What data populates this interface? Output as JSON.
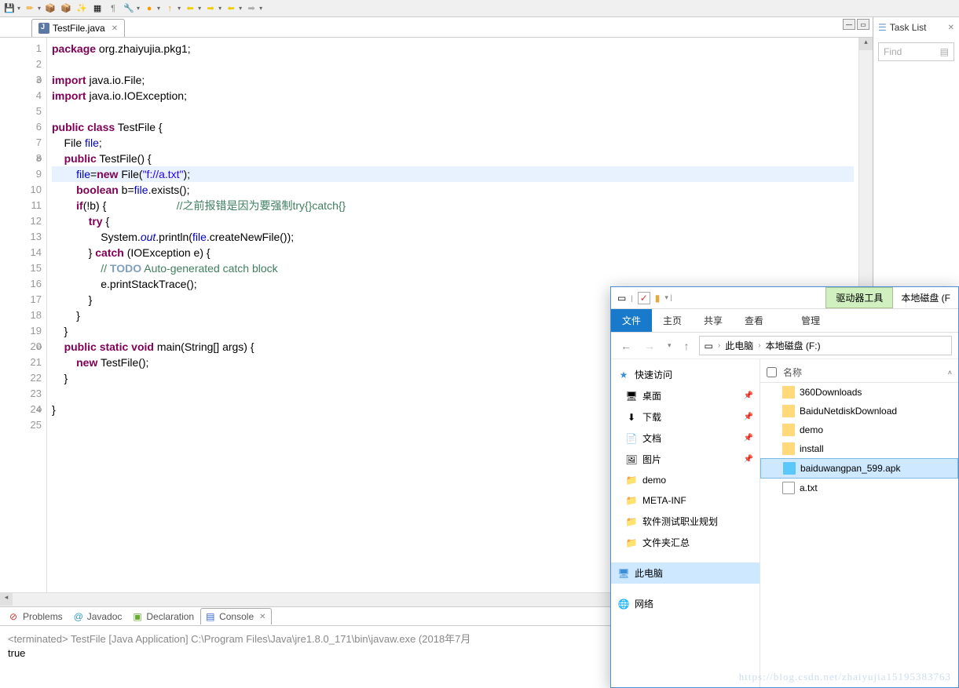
{
  "toolbar": {
    "icons": [
      "disk",
      "pencil",
      "box",
      "pkg",
      "run",
      "grid",
      "para",
      "wand",
      "dot",
      "up",
      "left",
      "right",
      "left2",
      "right2"
    ]
  },
  "tab": {
    "name": "TestFile.java",
    "close": "✕"
  },
  "code": {
    "lines": [
      {
        "n": 1,
        "html": "<span class='kw'>package</span> org.zhaiyujia.pkg1;"
      },
      {
        "n": 2,
        "html": ""
      },
      {
        "n": 3,
        "html": "<span class='kw'>import</span> java.io.File;",
        "fold": "⊖"
      },
      {
        "n": 4,
        "html": "<span class='kw'>import</span> java.io.IOException;"
      },
      {
        "n": 5,
        "html": ""
      },
      {
        "n": 6,
        "html": "<span class='kw'>public</span> <span class='kw'>class</span> TestFile {"
      },
      {
        "n": 7,
        "html": "    File <span class='fld'>file</span>;"
      },
      {
        "n": 8,
        "html": "    <span class='kw'>public</span> TestFile() {",
        "fold": "⊖"
      },
      {
        "n": 9,
        "html": "        <span class='fld'>file</span>=<span class='kw'>new</span> File(<span class='str'>\"f://a.txt\"</span>);",
        "hl": true
      },
      {
        "n": 10,
        "html": "        <span class='kw'>boolean</span> b=<span class='fld'>file</span>.exists();"
      },
      {
        "n": 11,
        "html": "        <span class='kw'>if</span>(!b) {                       <span class='cm'>//之前报错是因为要强制try{}catch{}</span>"
      },
      {
        "n": 12,
        "html": "            <span class='kw'>try</span> {"
      },
      {
        "n": 13,
        "html": "                System.<span class='sit'>out</span>.println(<span class='fld'>file</span>.createNewFile());"
      },
      {
        "n": 14,
        "html": "            } <span class='kw'>catch</span> (IOException e) {"
      },
      {
        "n": 15,
        "html": "                <span class='cm'>// </span><span class='todo'>TODO</span><span class='cm'> Auto-generated catch block</span>"
      },
      {
        "n": 16,
        "html": "                e.printStackTrace();"
      },
      {
        "n": 17,
        "html": "            }"
      },
      {
        "n": 18,
        "html": "        }"
      },
      {
        "n": 19,
        "html": "    }"
      },
      {
        "n": 20,
        "html": "    <span class='kw'>public</span> <span class='kw'>static</span> <span class='kw'>void</span> main(String[] args) {",
        "fold": "⊖"
      },
      {
        "n": 21,
        "html": "        <span class='kw'>new</span> TestFile();"
      },
      {
        "n": 22,
        "html": "    }"
      },
      {
        "n": 23,
        "html": ""
      },
      {
        "n": 24,
        "html": "}",
        "fold": ""
      },
      {
        "n": 25,
        "html": ""
      }
    ]
  },
  "bottomTabs": {
    "problems": "Problems",
    "javadoc": "Javadoc",
    "declaration": "Declaration",
    "console": "Console"
  },
  "console": {
    "head": "<terminated> TestFile [Java Application] C:\\Program Files\\Java\\jre1.8.0_171\\bin\\javaw.exe (2018年7月",
    "out": "true"
  },
  "task": {
    "title": "Task List",
    "find": "Find"
  },
  "explorer": {
    "drvTool": "驱动器工具",
    "drvName": "本地磁盘 (F",
    "tabs": {
      "file": "文件",
      "home": "主页",
      "share": "共享",
      "view": "查看",
      "manage": "管理"
    },
    "crumbs": {
      "pc": "此电脑",
      "drv": "本地磁盘 (F:)"
    },
    "quick": "快速访问",
    "nav": [
      {
        "label": "桌面",
        "pin": true,
        "ico": "🖥"
      },
      {
        "label": "下载",
        "pin": true,
        "ico": "⬇"
      },
      {
        "label": "文档",
        "pin": true,
        "ico": "📄"
      },
      {
        "label": "图片",
        "pin": true,
        "ico": "🖼"
      },
      {
        "label": "demo",
        "ico": "📁"
      },
      {
        "label": "META-INF",
        "ico": "📁"
      },
      {
        "label": "软件测试职业规划",
        "ico": "📁"
      },
      {
        "label": "文件夹汇总",
        "ico": "📁"
      }
    ],
    "thispc": "此电脑",
    "network": "网络",
    "listHead": "名称",
    "files": [
      {
        "name": "360Downloads",
        "type": "folder"
      },
      {
        "name": "BaiduNetdiskDownload",
        "type": "folder"
      },
      {
        "name": "demo",
        "type": "folder"
      },
      {
        "name": "install",
        "type": "folder"
      },
      {
        "name": "baiduwangpan_599.apk",
        "type": "apk",
        "sel": true
      },
      {
        "name": "a.txt",
        "type": "file"
      }
    ]
  },
  "watermark": "https://blog.csdn.net/zhaiyujia15195383763"
}
